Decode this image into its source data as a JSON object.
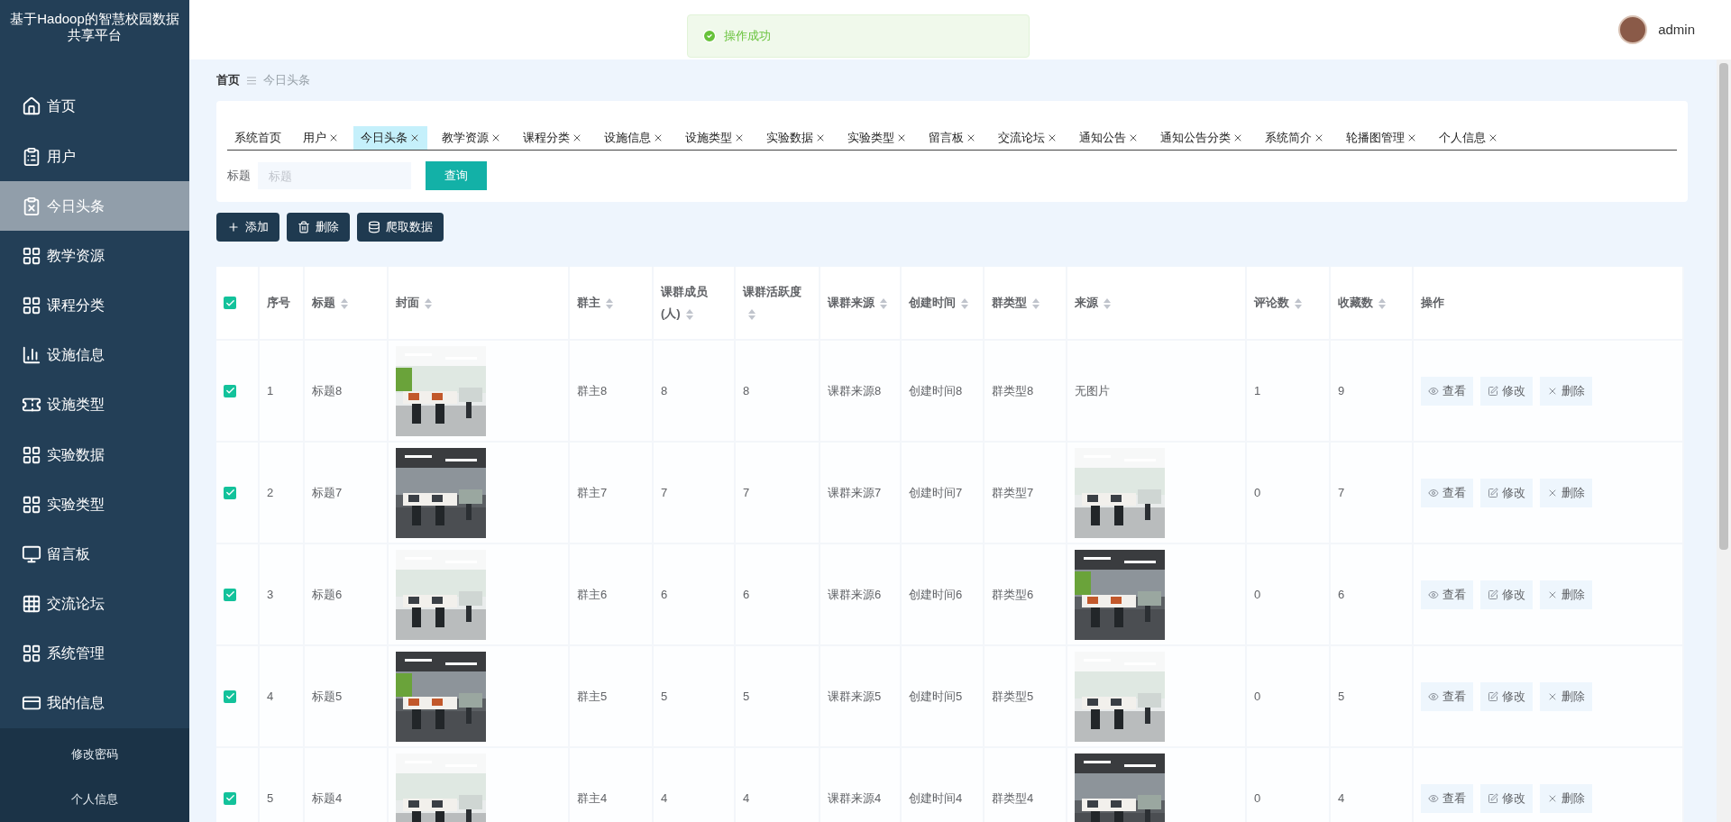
{
  "sidebar": {
    "title": "基于Hadoop的智慧校园数据共享平台",
    "items": [
      {
        "label": "首页",
        "selected": false
      },
      {
        "label": "用户",
        "selected": false
      },
      {
        "label": "今日头条",
        "selected": true
      },
      {
        "label": "教学资源",
        "selected": false
      },
      {
        "label": "课程分类",
        "selected": false
      },
      {
        "label": "设施信息",
        "selected": false
      },
      {
        "label": "设施类型",
        "selected": false
      },
      {
        "label": "实验数据",
        "selected": false
      },
      {
        "label": "实验类型",
        "selected": false
      },
      {
        "label": "留言板",
        "selected": false
      },
      {
        "label": "交流论坛",
        "selected": false
      },
      {
        "label": "系统管理",
        "selected": false
      },
      {
        "label": "我的信息",
        "selected": false
      }
    ],
    "submenu": [
      {
        "label": "修改密码"
      },
      {
        "label": "个人信息"
      }
    ]
  },
  "header": {
    "user": "admin"
  },
  "toast": {
    "message": "操作成功"
  },
  "breadcrumb": [
    "首页",
    "今日头条"
  ],
  "tabs": [
    {
      "label": "系统首页",
      "closable": false,
      "selected": false
    },
    {
      "label": "用户",
      "closable": true,
      "selected": false
    },
    {
      "label": "今日头条",
      "closable": true,
      "selected": true
    },
    {
      "label": "教学资源",
      "closable": true,
      "selected": false
    },
    {
      "label": "课程分类",
      "closable": true,
      "selected": false
    },
    {
      "label": "设施信息",
      "closable": true,
      "selected": false
    },
    {
      "label": "设施类型",
      "closable": true,
      "selected": false
    },
    {
      "label": "实验数据",
      "closable": true,
      "selected": false
    },
    {
      "label": "实验类型",
      "closable": true,
      "selected": false
    },
    {
      "label": "留言板",
      "closable": true,
      "selected": false
    },
    {
      "label": "交流论坛",
      "closable": true,
      "selected": false
    },
    {
      "label": "通知公告",
      "closable": true,
      "selected": false
    },
    {
      "label": "通知公告分类",
      "closable": true,
      "selected": false
    },
    {
      "label": "系统简介",
      "closable": true,
      "selected": false
    },
    {
      "label": "轮播图管理",
      "closable": true,
      "selected": false
    },
    {
      "label": "个人信息",
      "closable": true,
      "selected": false
    }
  ],
  "search": {
    "label": "标题",
    "placeholder": "标题",
    "button": "查询"
  },
  "actions": [
    {
      "label": "添加",
      "kind": "add"
    },
    {
      "label": "删除",
      "kind": "delete"
    },
    {
      "label": "爬取数据",
      "kind": "crawl"
    }
  ],
  "table": {
    "header_checked": true,
    "columns": [
      {
        "label": "序号",
        "sortable": false
      },
      {
        "label": "标题",
        "sortable": true
      },
      {
        "label": "封面",
        "sortable": true
      },
      {
        "label": "群主",
        "sortable": true
      },
      {
        "label": "课群成员(人)",
        "sortable": true
      },
      {
        "label": "课群活跃度",
        "sortable": true
      },
      {
        "label": "课群来源",
        "sortable": true
      },
      {
        "label": "创建时间",
        "sortable": true
      },
      {
        "label": "群类型",
        "sortable": true
      },
      {
        "label": "来源",
        "sortable": true
      },
      {
        "label": "评论数",
        "sortable": true
      },
      {
        "label": "收藏数",
        "sortable": true
      },
      {
        "label": "操作",
        "sortable": false
      }
    ],
    "rows": [
      {
        "checked": true,
        "index": "1",
        "title": "标题8",
        "owner": "群主8",
        "members": "8",
        "activity": "8",
        "group_source": "课群来源8",
        "created": "创建时间8",
        "type": "群类型8",
        "source": {
          "kind": "text",
          "text": "无图片"
        },
        "comments": "1",
        "favorites": "9",
        "buttons": [
          {
            "label": "查看",
            "kind": "view"
          },
          {
            "label": "修改",
            "kind": "edit"
          },
          {
            "label": "删除",
            "kind": "delete"
          }
        ]
      },
      {
        "checked": true,
        "index": "2",
        "title": "标题7",
        "owner": "群主7",
        "members": "7",
        "activity": "7",
        "group_source": "课群来源7",
        "created": "创建时间7",
        "type": "群类型7",
        "comments": "0",
        "favorites": "7",
        "buttons": [
          {
            "label": "查看",
            "kind": "view"
          },
          {
            "label": "修改",
            "kind": "edit"
          },
          {
            "label": "删除",
            "kind": "delete"
          }
        ]
      },
      {
        "checked": true,
        "index": "3",
        "title": "标题6",
        "owner": "群主6",
        "members": "6",
        "activity": "6",
        "group_source": "课群来源6",
        "created": "创建时间6",
        "type": "群类型6",
        "comments": "0",
        "favorites": "6",
        "buttons": [
          {
            "label": "查看",
            "kind": "view"
          },
          {
            "label": "修改",
            "kind": "edit"
          },
          {
            "label": "删除",
            "kind": "delete"
          }
        ]
      },
      {
        "checked": true,
        "index": "4",
        "title": "标题5",
        "owner": "群主5",
        "members": "5",
        "activity": "5",
        "group_source": "课群来源5",
        "created": "创建时间5",
        "type": "群类型5",
        "comments": "0",
        "favorites": "5",
        "buttons": [
          {
            "label": "查看",
            "kind": "view"
          },
          {
            "label": "修改",
            "kind": "edit"
          },
          {
            "label": "删除",
            "kind": "delete"
          }
        ]
      },
      {
        "checked": true,
        "index": "5",
        "title": "标题4",
        "owner": "群主4",
        "members": "4",
        "activity": "4",
        "group_source": "课群来源4",
        "created": "创建时间4",
        "type": "群类型4",
        "comments": "0",
        "favorites": "4",
        "buttons": [
          {
            "label": "查看",
            "kind": "view"
          },
          {
            "label": "修改",
            "kind": "edit"
          },
          {
            "label": "删除",
            "kind": "delete"
          }
        ]
      }
    ]
  }
}
